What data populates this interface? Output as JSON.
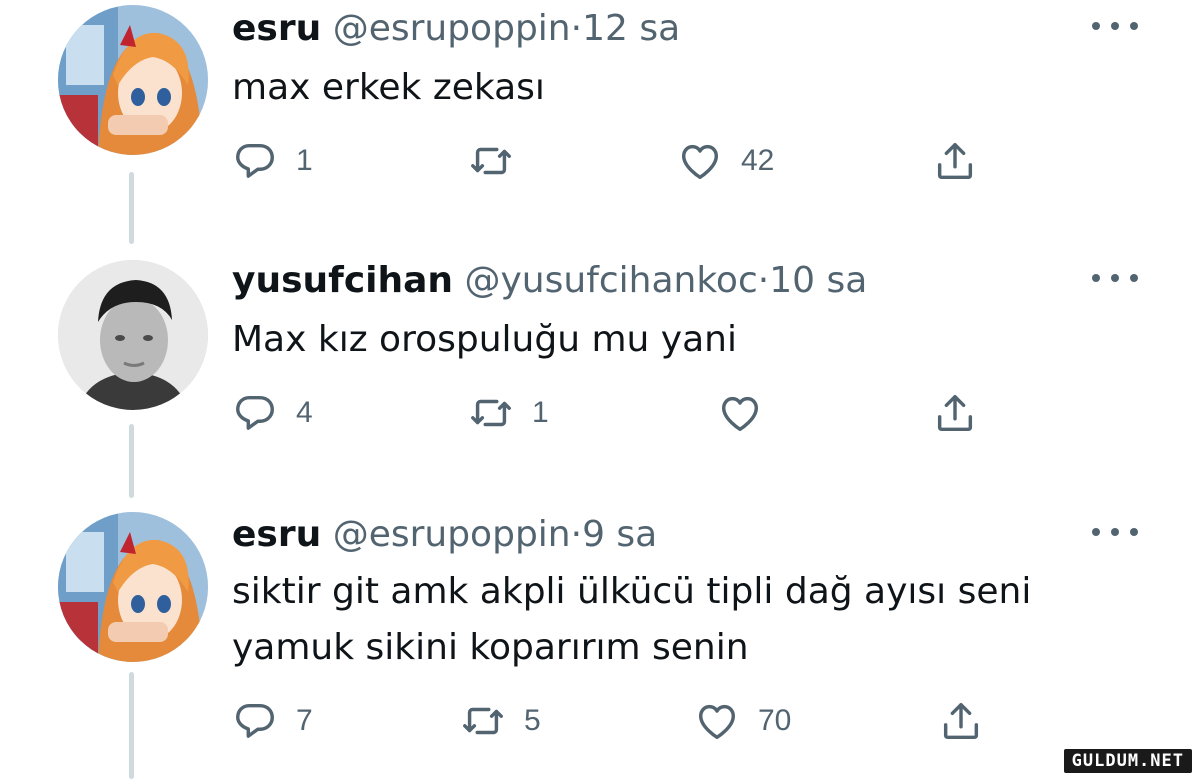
{
  "tweets": [
    {
      "name": "esru",
      "handle": "@esrupoppin",
      "separator": "·",
      "time": "12 sa",
      "text": "max erkek zekası",
      "reply_count": "1",
      "retweet_count": "",
      "like_count": "42",
      "avatar": "anime-girl-avatar"
    },
    {
      "name": "yusufcihan",
      "handle": "@yusufcihankoc",
      "separator": "·",
      "time": "10 sa",
      "text": "Max kız orospuluğu mu yani",
      "reply_count": "4",
      "retweet_count": "1",
      "like_count": "",
      "avatar": "young-man-avatar"
    },
    {
      "name": "esru",
      "handle": "@esrupoppin",
      "separator": "·",
      "time": "9 sa",
      "text": "siktir git amk akpli ülkücü tipli dağ ayısı seni\nyamuk sikini koparırım senin",
      "reply_count": "7",
      "retweet_count": "5",
      "like_count": "70",
      "avatar": "anime-girl-avatar"
    }
  ],
  "watermark": "GULDUM.NET",
  "colors": {
    "text": "#0f1419",
    "secondary": "#536471",
    "thread_line": "#cfd9de",
    "background": "#ffffff"
  },
  "icons": [
    "reply-icon",
    "retweet-icon",
    "like-icon",
    "share-icon",
    "more-icon"
  ]
}
